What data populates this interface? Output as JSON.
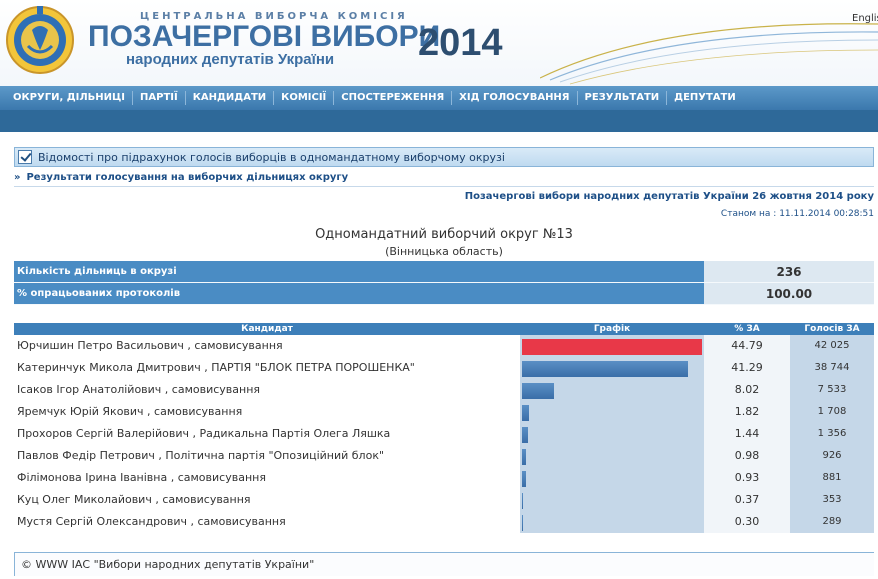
{
  "header": {
    "org": "ЦЕНТРАЛЬНА ВИБОРЧА КОМІСІЯ",
    "title": "ПОЗАЧЕРГОВІ ВИБОРИ",
    "subtitle": "народних депутатів України",
    "year": "2014",
    "lang": "English",
    "emblem_icon": "cvk-emblem-icon"
  },
  "nav": {
    "items": [
      "ОКРУГИ, ДІЛЬНИЦІ",
      "ПАРТІЇ",
      "КАНДИДАТИ",
      "КОМІСІЇ",
      "СПОСТЕРЕЖЕННЯ",
      "ХІД ГОЛОСУВАННЯ",
      "РЕЗУЛЬТАТИ",
      "ДЕПУТАТИ"
    ]
  },
  "section": {
    "heading": "Відомості про підрахунок голосів виборців в одномандатному виборчому окрузі",
    "sublink": "Результати голосування на виборчих дільницях округу",
    "election": "Позачергові вибори народних депутатів України 26 жовтня 2014 року",
    "status_label": "Станом на :",
    "status_date": "11.11.2014 00:28:51",
    "district": "Одномандатний виборчий округ №13",
    "region": "(Вінницька область)"
  },
  "summary": [
    {
      "label": "Кількість дільниць в окрузі",
      "value": "236"
    },
    {
      "label": "% опрацьованих протоколів",
      "value": "100.00"
    }
  ],
  "results": {
    "headers": [
      "Кандидат",
      "Графік",
      "% ЗА",
      "Голосів ЗА"
    ],
    "bar_color_top": "#e83848",
    "bar_color": "#3a6ea8",
    "rows": [
      {
        "candidate": "Юрчишин Петро Васильович , самовисування",
        "pct": "44.79",
        "votes": "42 025",
        "share": 44.79
      },
      {
        "candidate": "Катеринчук Микола Дмитрович , ПАРТІЯ \"БЛОК ПЕТРА ПОРОШЕНКА\"",
        "pct": "41.29",
        "votes": "38 744",
        "share": 41.29
      },
      {
        "candidate": "Ісаков Ігор Анатолійович , самовисування",
        "pct": "8.02",
        "votes": "7 533",
        "share": 8.02
      },
      {
        "candidate": "Яремчук Юрій Якович , самовисування",
        "pct": "1.82",
        "votes": "1 708",
        "share": 1.82
      },
      {
        "candidate": "Прохоров Сергій Валерійович , Радикальна Партія Олега Ляшка",
        "pct": "1.44",
        "votes": "1 356",
        "share": 1.44
      },
      {
        "candidate": "Павлов Федір Петрович , Політична партія \"Опозиційний блок\"",
        "pct": "0.98",
        "votes": "926",
        "share": 0.98
      },
      {
        "candidate": "Філімонова Ірина Іванівна , самовисування",
        "pct": "0.93",
        "votes": "881",
        "share": 0.93
      },
      {
        "candidate": "Куц Олег Миколайович , самовисування",
        "pct": "0.37",
        "votes": "353",
        "share": 0.37
      },
      {
        "candidate": "Мустя Сергій Олександрович , самовисування",
        "pct": "0.30",
        "votes": "289",
        "share": 0.3
      }
    ]
  },
  "footer": {
    "text": "© WWW ІАС \"Вибори народних депутатів України\""
  }
}
